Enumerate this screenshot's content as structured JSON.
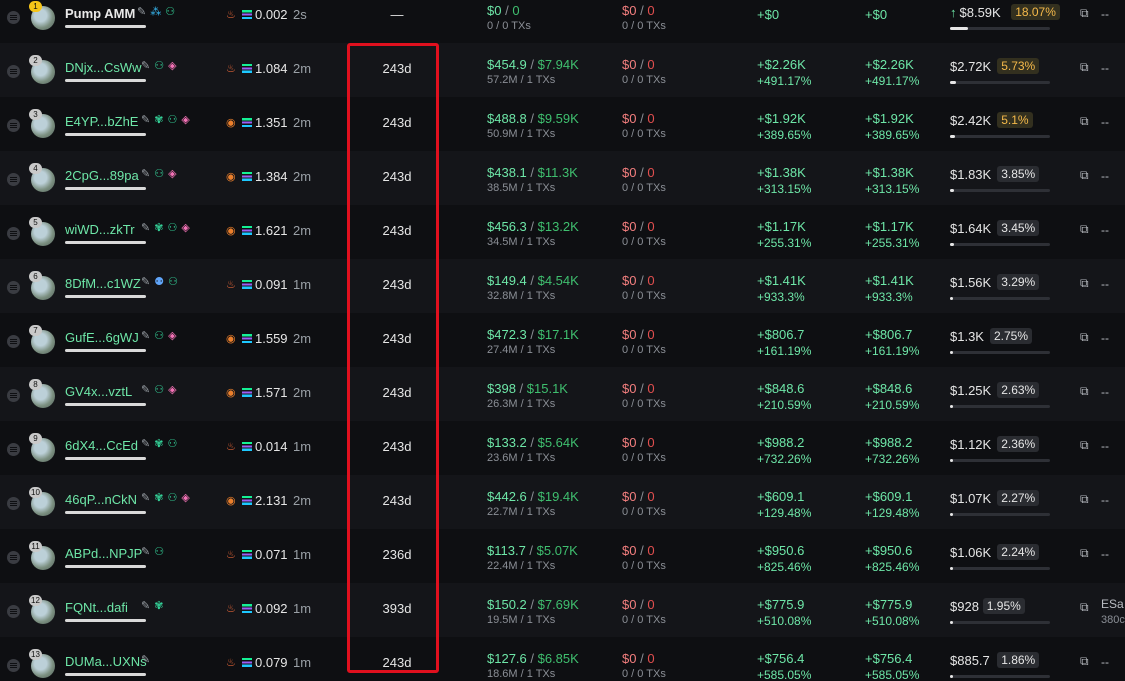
{
  "colors": {
    "positive": "#6ee7a8",
    "negative": "#f47f7f",
    "highlight": "#e0101e",
    "badge_hot": "#f5b94a"
  },
  "icons": {
    "menu": "menu-icon",
    "source_fire": "fire-icon",
    "source_snail": "snail-icon",
    "chain": "solana-icon",
    "action": "share-icon"
  },
  "rows": [
    {
      "rank": "1",
      "name": "Pump AMM",
      "name_style": "white",
      "tags": [
        "edit",
        "drop",
        "user"
      ],
      "source": "fire",
      "balance": "0.002",
      "age": "2s",
      "holding": "—",
      "buy_usd": "$0",
      "buy_usd2": "0",
      "buy_sub": "0 / 0 TXs",
      "sell_usd": "$0",
      "sell_usd2": "0",
      "sell_sub": "0 / 0 TXs",
      "pnl1": "+$0",
      "pnl1_pct": "",
      "pnl2": "+$0",
      "pnl2_pct": "",
      "value": "$8.59K",
      "value_up": "↑",
      "pct": "18.07%",
      "pct_hot": true,
      "progress": 0.18,
      "action": "--",
      "action_sub": ""
    },
    {
      "rank": "2",
      "name": "DNjx...CsWw",
      "name_style": "green",
      "tags": [
        "edit",
        "user",
        "layer"
      ],
      "source": "fire",
      "balance": "1.084",
      "age": "2m",
      "holding": "243d",
      "buy_usd": "$454.9",
      "buy_usd2": "$7.94K",
      "buy_sub": "57.2M / 1 TXs",
      "sell_usd": "$0",
      "sell_usd2": "0",
      "sell_sub": "0 / 0 TXs",
      "pnl1": "+$2.26K",
      "pnl1_pct": "+491.17%",
      "pnl2": "+$2.26K",
      "pnl2_pct": "+491.17%",
      "value": "$2.72K",
      "value_up": "",
      "pct": "5.73%",
      "pct_hot": true,
      "progress": 0.06,
      "action": "--",
      "action_sub": ""
    },
    {
      "rank": "3",
      "name": "E4YP...bZhE",
      "name_style": "green",
      "tags": [
        "edit",
        "bug",
        "user",
        "layer"
      ],
      "source": "snail",
      "balance": "1.351",
      "age": "2m",
      "holding": "243d",
      "buy_usd": "$488.8",
      "buy_usd2": "$9.59K",
      "buy_sub": "50.9M / 1 TXs",
      "sell_usd": "$0",
      "sell_usd2": "0",
      "sell_sub": "0 / 0 TXs",
      "pnl1": "+$1.92K",
      "pnl1_pct": "+389.65%",
      "pnl2": "+$1.92K",
      "pnl2_pct": "+389.65%",
      "value": "$2.42K",
      "value_up": "",
      "pct": "5.1%",
      "pct_hot": true,
      "progress": 0.05,
      "action": "--",
      "action_sub": ""
    },
    {
      "rank": "4",
      "name": "2CpG...89pa",
      "name_style": "green",
      "tags": [
        "edit",
        "user",
        "layer"
      ],
      "source": "snail",
      "balance": "1.384",
      "age": "2m",
      "holding": "243d",
      "buy_usd": "$438.1",
      "buy_usd2": "$11.3K",
      "buy_sub": "38.5M / 1 TXs",
      "sell_usd": "$0",
      "sell_usd2": "0",
      "sell_sub": "0 / 0 TXs",
      "pnl1": "+$1.38K",
      "pnl1_pct": "+313.15%",
      "pnl2": "+$1.38K",
      "pnl2_pct": "+313.15%",
      "value": "$1.83K",
      "value_up": "",
      "pct": "3.85%",
      "pct_hot": false,
      "progress": 0.04,
      "action": "--",
      "action_sub": ""
    },
    {
      "rank": "5",
      "name": "wiWD...zkTr",
      "name_style": "green",
      "tags": [
        "edit",
        "bug",
        "user",
        "layer"
      ],
      "source": "snail",
      "balance": "1.621",
      "age": "2m",
      "holding": "243d",
      "buy_usd": "$456.3",
      "buy_usd2": "$13.2K",
      "buy_sub": "34.5M / 1 TXs",
      "sell_usd": "$0",
      "sell_usd2": "0",
      "sell_sub": "0 / 0 TXs",
      "pnl1": "+$1.17K",
      "pnl1_pct": "+255.31%",
      "pnl2": "+$1.17K",
      "pnl2_pct": "+255.31%",
      "value": "$1.64K",
      "value_up": "",
      "pct": "3.45%",
      "pct_hot": false,
      "progress": 0.035,
      "action": "--",
      "action_sub": ""
    },
    {
      "rank": "6",
      "name": "8DfM...c1WZ",
      "name_style": "green",
      "tags": [
        "edit",
        "bubble",
        "user"
      ],
      "source": "fire",
      "balance": "0.091",
      "age": "1m",
      "holding": "243d",
      "buy_usd": "$149.4",
      "buy_usd2": "$4.54K",
      "buy_sub": "32.8M / 1 TXs",
      "sell_usd": "$0",
      "sell_usd2": "0",
      "sell_sub": "0 / 0 TXs",
      "pnl1": "+$1.41K",
      "pnl1_pct": "+933.3%",
      "pnl2": "+$1.41K",
      "pnl2_pct": "+933.3%",
      "value": "$1.56K",
      "value_up": "",
      "pct": "3.29%",
      "pct_hot": false,
      "progress": 0.033,
      "action": "--",
      "action_sub": ""
    },
    {
      "rank": "7",
      "name": "GufE...6gWJ",
      "name_style": "green",
      "tags": [
        "edit",
        "user",
        "layer"
      ],
      "source": "snail",
      "balance": "1.559",
      "age": "2m",
      "holding": "243d",
      "buy_usd": "$472.3",
      "buy_usd2": "$17.1K",
      "buy_sub": "27.4M / 1 TXs",
      "sell_usd": "$0",
      "sell_usd2": "0",
      "sell_sub": "0 / 0 TXs",
      "pnl1": "+$806.7",
      "pnl1_pct": "+161.19%",
      "pnl2": "+$806.7",
      "pnl2_pct": "+161.19%",
      "value": "$1.3K",
      "value_up": "",
      "pct": "2.75%",
      "pct_hot": false,
      "progress": 0.028,
      "action": "--",
      "action_sub": ""
    },
    {
      "rank": "8",
      "name": "GV4x...vztL",
      "name_style": "green",
      "tags": [
        "edit",
        "user",
        "layer"
      ],
      "source": "snail",
      "balance": "1.571",
      "age": "2m",
      "holding": "243d",
      "buy_usd": "$398",
      "buy_usd2": "$15.1K",
      "buy_sub": "26.3M / 1 TXs",
      "sell_usd": "$0",
      "sell_usd2": "0",
      "sell_sub": "0 / 0 TXs",
      "pnl1": "+$848.6",
      "pnl1_pct": "+210.59%",
      "pnl2": "+$848.6",
      "pnl2_pct": "+210.59%",
      "value": "$1.25K",
      "value_up": "",
      "pct": "2.63%",
      "pct_hot": false,
      "progress": 0.026,
      "action": "--",
      "action_sub": ""
    },
    {
      "rank": "9",
      "name": "6dX4...CcEd",
      "name_style": "green",
      "tags": [
        "edit",
        "bug",
        "user"
      ],
      "source": "fire",
      "balance": "0.014",
      "age": "1m",
      "holding": "243d",
      "buy_usd": "$133.2",
      "buy_usd2": "$5.64K",
      "buy_sub": "23.6M / 1 TXs",
      "sell_usd": "$0",
      "sell_usd2": "0",
      "sell_sub": "0 / 0 TXs",
      "pnl1": "+$988.2",
      "pnl1_pct": "+732.26%",
      "pnl2": "+$988.2",
      "pnl2_pct": "+732.26%",
      "value": "$1.12K",
      "value_up": "",
      "pct": "2.36%",
      "pct_hot": false,
      "progress": 0.024,
      "action": "--",
      "action_sub": ""
    },
    {
      "rank": "10",
      "name": "46qP...nCkN",
      "name_style": "green",
      "tags": [
        "edit",
        "bug",
        "user",
        "layer"
      ],
      "source": "snail",
      "balance": "2.131",
      "age": "2m",
      "holding": "243d",
      "buy_usd": "$442.6",
      "buy_usd2": "$19.4K",
      "buy_sub": "22.7M / 1 TXs",
      "sell_usd": "$0",
      "sell_usd2": "0",
      "sell_sub": "0 / 0 TXs",
      "pnl1": "+$609.1",
      "pnl1_pct": "+129.48%",
      "pnl2": "+$609.1",
      "pnl2_pct": "+129.48%",
      "value": "$1.07K",
      "value_up": "",
      "pct": "2.27%",
      "pct_hot": false,
      "progress": 0.023,
      "action": "--",
      "action_sub": ""
    },
    {
      "rank": "11",
      "name": "ABPd...NPJP",
      "name_style": "green",
      "tags": [
        "edit",
        "user"
      ],
      "source": "fire",
      "balance": "0.071",
      "age": "1m",
      "holding": "236d",
      "buy_usd": "$113.7",
      "buy_usd2": "$5.07K",
      "buy_sub": "22.4M / 1 TXs",
      "sell_usd": "$0",
      "sell_usd2": "0",
      "sell_sub": "0 / 0 TXs",
      "pnl1": "+$950.6",
      "pnl1_pct": "+825.46%",
      "pnl2": "+$950.6",
      "pnl2_pct": "+825.46%",
      "value": "$1.06K",
      "value_up": "",
      "pct": "2.24%",
      "pct_hot": false,
      "progress": 0.022,
      "action": "--",
      "action_sub": ""
    },
    {
      "rank": "12",
      "name": "FQNt...dafi",
      "name_style": "green",
      "tags": [
        "edit",
        "bug"
      ],
      "source": "fire",
      "balance": "0.092",
      "age": "1m",
      "holding": "393d",
      "buy_usd": "$150.2",
      "buy_usd2": "$7.69K",
      "buy_sub": "19.5M / 1 TXs",
      "sell_usd": "$0",
      "sell_usd2": "0",
      "sell_sub": "0 / 0 TXs",
      "pnl1": "+$775.9",
      "pnl1_pct": "+510.08%",
      "pnl2": "+$775.9",
      "pnl2_pct": "+510.08%",
      "value": "$928",
      "value_up": "",
      "pct": "1.95%",
      "pct_hot": false,
      "progress": 0.02,
      "action": "ESa",
      "action_sub": "380c"
    },
    {
      "rank": "13",
      "name": "DUMa...UXNs",
      "name_style": "green",
      "tags": [
        "edit"
      ],
      "source": "fire",
      "balance": "0.079",
      "age": "1m",
      "holding": "243d",
      "buy_usd": "$127.6",
      "buy_usd2": "$6.85K",
      "buy_sub": "18.6M / 1 TXs",
      "sell_usd": "$0",
      "sell_usd2": "0",
      "sell_sub": "0 / 0 TXs",
      "pnl1": "+$756.4",
      "pnl1_pct": "+585.05%",
      "pnl2": "+$756.4",
      "pnl2_pct": "+585.05%",
      "value": "$885.7",
      "value_up": "",
      "pct": "1.86%",
      "pct_hot": false,
      "progress": 0.019,
      "action": "--",
      "action_sub": ""
    }
  ]
}
